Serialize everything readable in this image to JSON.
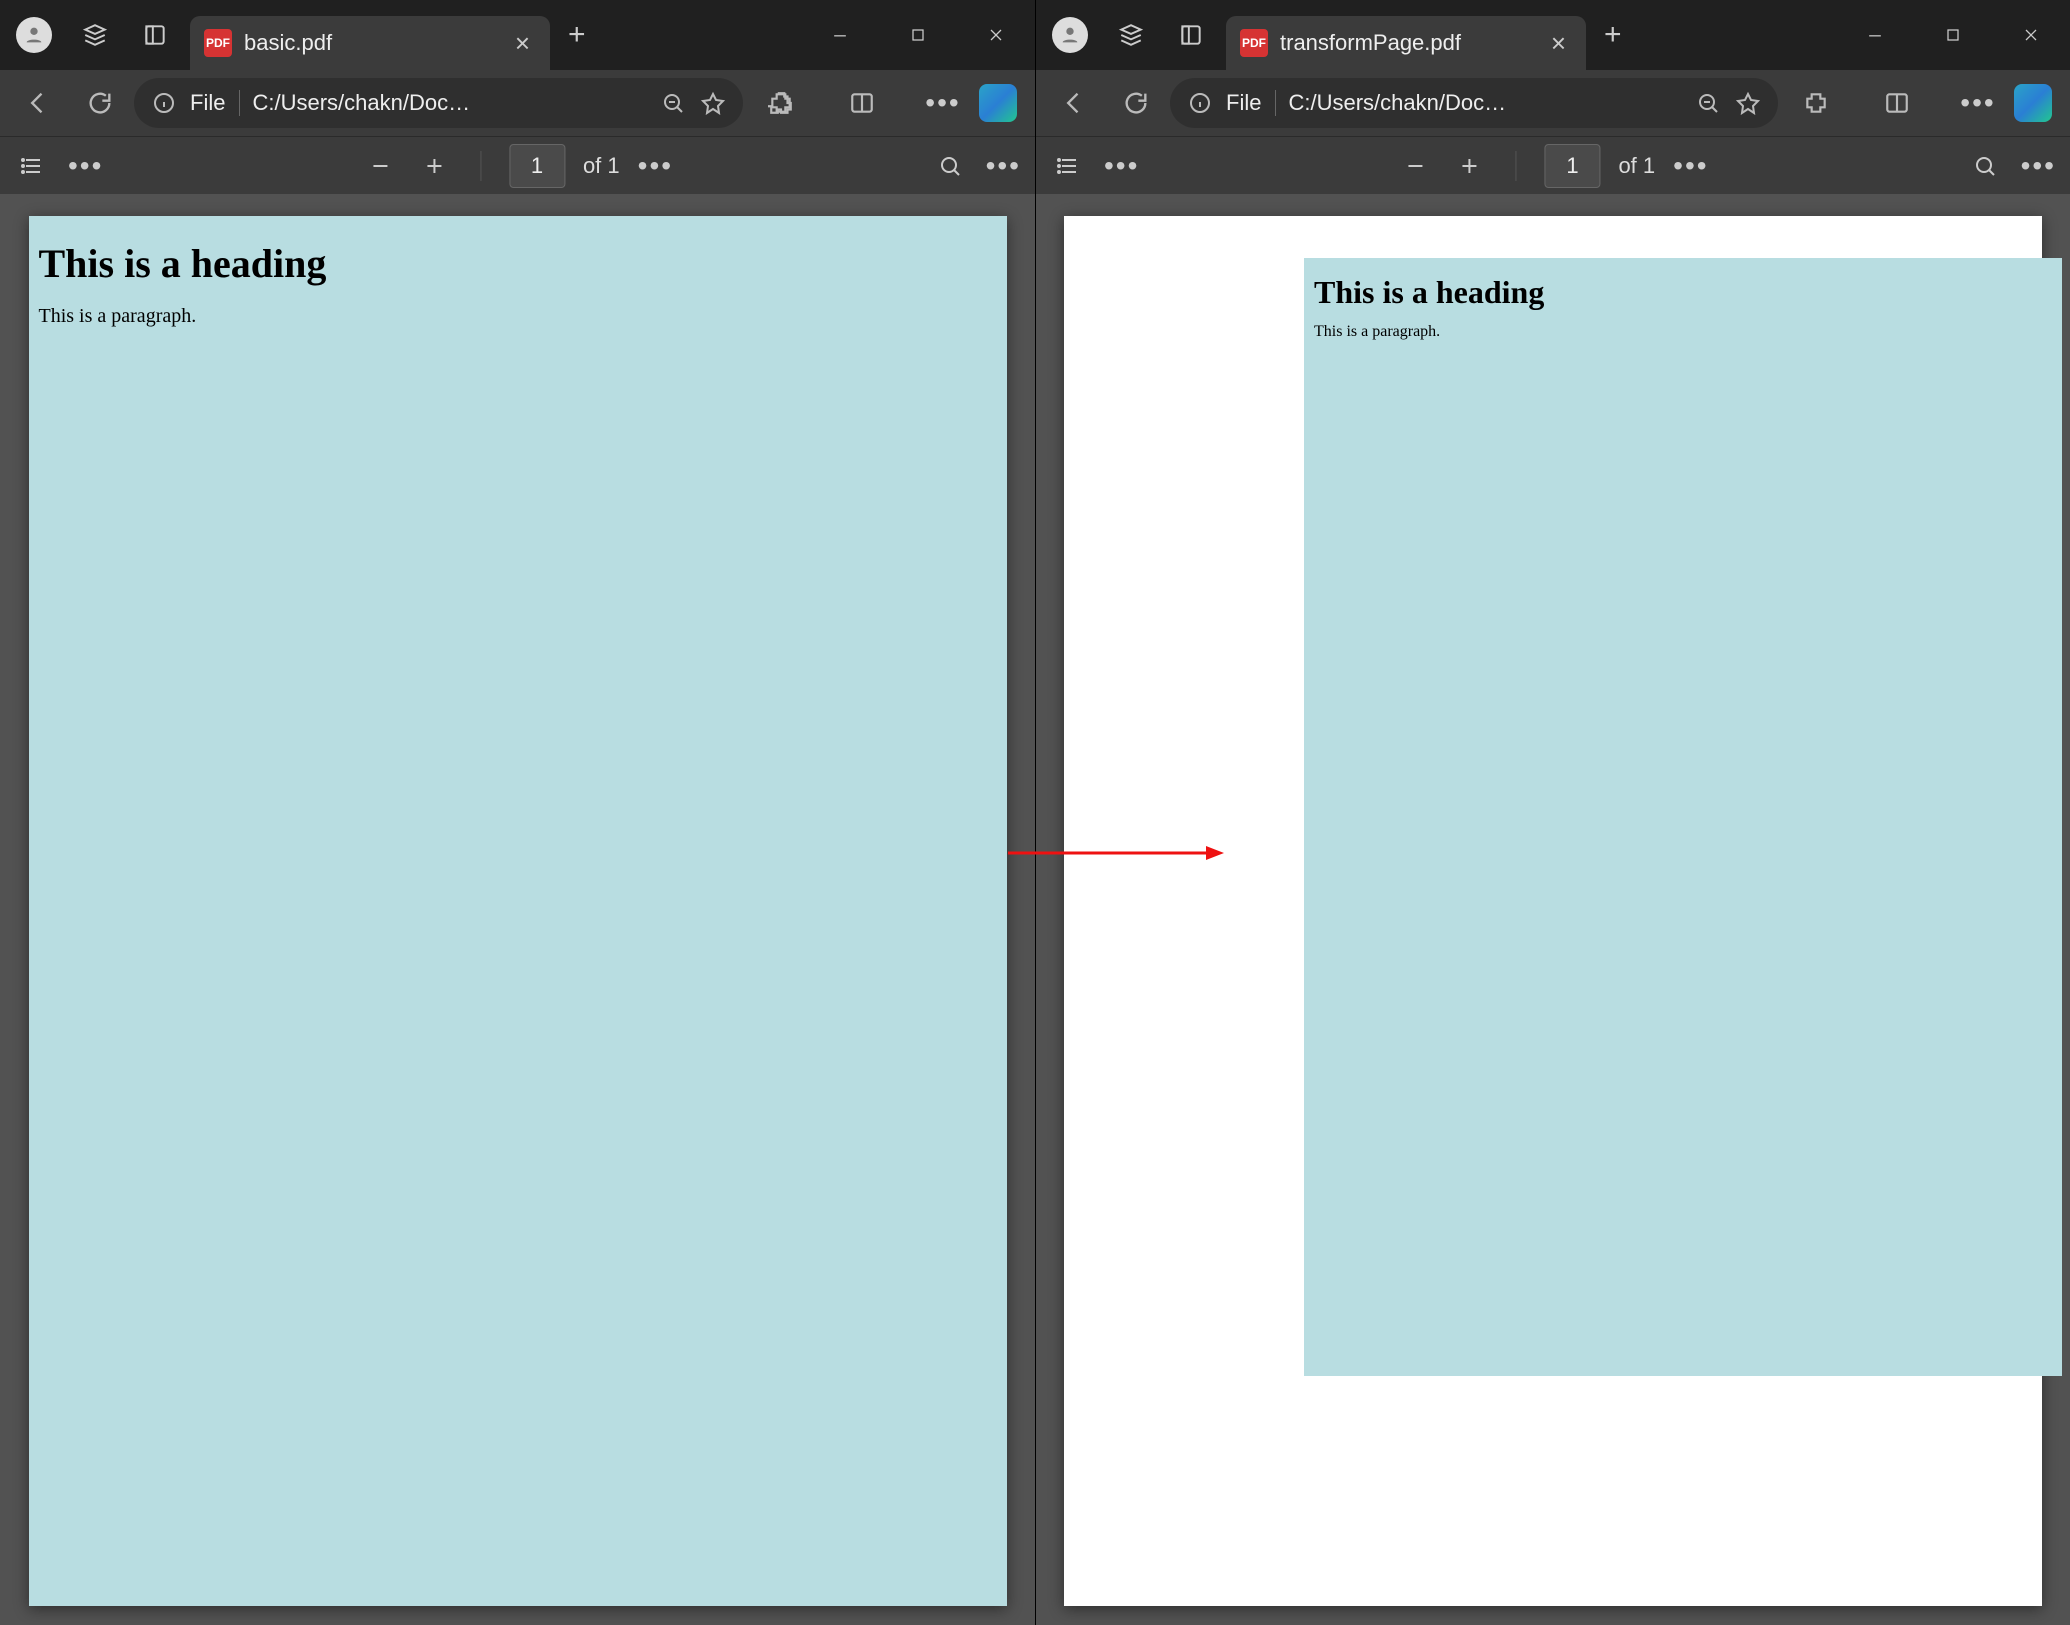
{
  "left": {
    "tab": {
      "title": "basic.pdf"
    },
    "url": {
      "scheme_label": "File",
      "path": "C:/Users/chakn/Doc…"
    },
    "pdfbar": {
      "page_input": "1",
      "page_of": "of 1"
    },
    "document": {
      "heading": "This is a heading",
      "paragraph": "This is a paragraph."
    }
  },
  "right": {
    "tab": {
      "title": "transformPage.pdf"
    },
    "url": {
      "scheme_label": "File",
      "path": "C:/Users/chakn/Doc…"
    },
    "pdfbar": {
      "page_input": "1",
      "page_of": "of 1"
    },
    "document": {
      "heading": "This is a heading",
      "paragraph": "This is a paragraph."
    }
  }
}
